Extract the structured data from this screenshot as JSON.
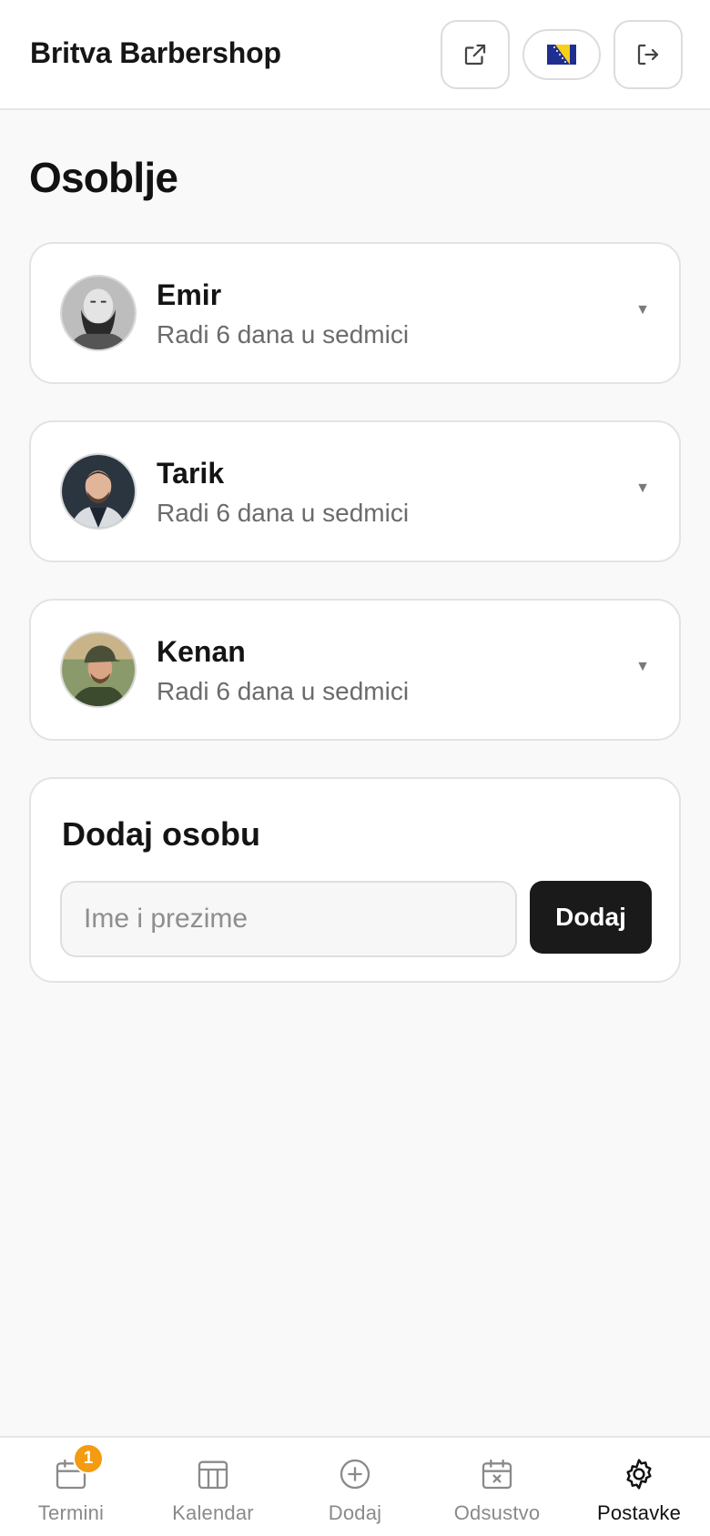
{
  "header": {
    "title": "Britva Barbershop",
    "external_icon": "external-link-icon",
    "language_flag": "flag-bosnia-icon",
    "logout_icon": "logout-icon"
  },
  "page": {
    "title": "Osoblje"
  },
  "staff": [
    {
      "name": "Emir",
      "schedule": "Radi 6 dana u sedmici",
      "caret": "▼"
    },
    {
      "name": "Tarik",
      "schedule": "Radi 6 dana u sedmici",
      "caret": "▼"
    },
    {
      "name": "Kenan",
      "schedule": "Radi 6 dana u sedmici",
      "caret": "▼"
    }
  ],
  "add_person": {
    "title": "Dodaj osobu",
    "placeholder": "Ime i prezime",
    "value": "",
    "button_label": "Dodaj"
  },
  "bottom_nav": {
    "items": [
      {
        "label": "Termini",
        "icon": "calendar-icon",
        "badge": "1"
      },
      {
        "label": "Kalendar",
        "icon": "columns-icon"
      },
      {
        "label": "Dodaj",
        "icon": "plus-circle-icon"
      },
      {
        "label": "Odsustvo",
        "icon": "calendar-x-icon"
      },
      {
        "label": "Postavke",
        "icon": "gear-icon",
        "active": true
      }
    ]
  },
  "colors": {
    "accent": "#1a1a1a",
    "badge": "#f39c12",
    "background": "#f9f9f9"
  }
}
